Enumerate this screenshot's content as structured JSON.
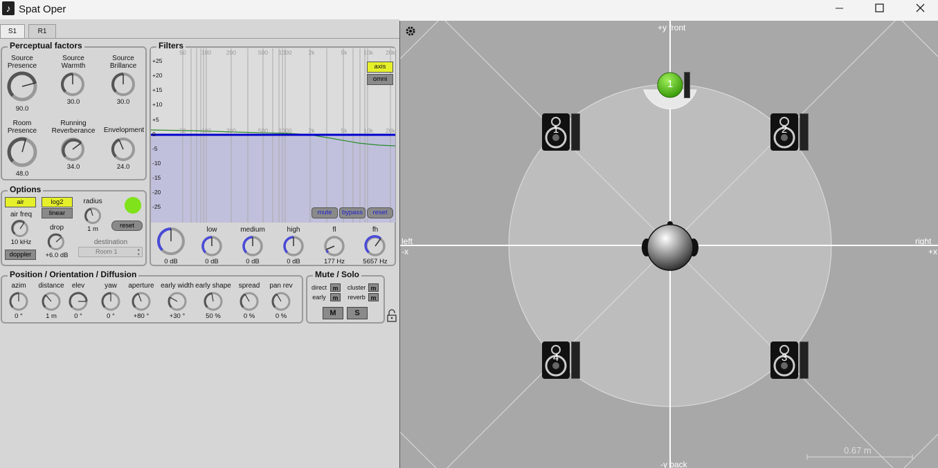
{
  "window": {
    "title": "Spat Oper",
    "app_icon": "music-note-icon",
    "controls": [
      "minimize-icon",
      "maximize-icon",
      "close-icon"
    ]
  },
  "tabs": [
    {
      "label": "S1",
      "active": true
    },
    {
      "label": "R1",
      "active": false
    }
  ],
  "perceptual": {
    "title": "Perceptual factors",
    "knobs": [
      {
        "label": "Source Presence",
        "value": "90.0"
      },
      {
        "label": "Source Warmth",
        "value": "30.0"
      },
      {
        "label": "Source Brillance",
        "value": "30.0"
      },
      {
        "label": "Room Presence",
        "value": "48.0"
      },
      {
        "label": "Running Reverberance",
        "value": "34.0"
      },
      {
        "label": "Envelopment",
        "value": "24.0"
      }
    ]
  },
  "filters": {
    "title": "Filters",
    "freq_labels": [
      "50",
      "100",
      "200",
      "500",
      "1000",
      "2k",
      "5k",
      "10k",
      "20k"
    ],
    "db_labels": [
      "+25",
      "+20",
      "+15",
      "+10",
      "+5",
      "0",
      "-5",
      "-10",
      "-15",
      "-20",
      "-25"
    ],
    "axis_label": "axis",
    "omni_label": "omni",
    "mute_label": "mute",
    "bypass_label": "bypass",
    "reset_label": "reset",
    "knobs": [
      {
        "label": "",
        "value": "0 dB"
      },
      {
        "label": "low",
        "value": "0 dB"
      },
      {
        "label": "medium",
        "value": "0 dB"
      },
      {
        "label": "high",
        "value": "0 dB"
      },
      {
        "label": "fl",
        "value": "177 Hz"
      },
      {
        "label": "fh",
        "value": "5657 Hz"
      }
    ]
  },
  "options": {
    "title": "Options",
    "air_label": "air",
    "log2_label": "log2",
    "linear_label": "linear",
    "radius_label": "radius",
    "radius_value": "1 m",
    "reset_label": "reset",
    "air_freq_label": "air freq",
    "air_freq_value": "10 kHz",
    "drop_label": "drop",
    "drop_value": "+6.0 dB",
    "destination_label": "destination",
    "destination_value": "Room 1",
    "doppler_label": "doppler"
  },
  "position": {
    "title": "Position / Orientation / Diffusion",
    "knobs": [
      {
        "label": "azim",
        "value": "0 °"
      },
      {
        "label": "distance",
        "value": "1 m"
      },
      {
        "label": "elev",
        "value": "0 °"
      },
      {
        "label": "yaw",
        "value": "0 °"
      },
      {
        "label": "aperture",
        "value": "+80 °"
      },
      {
        "label": "early width",
        "value": "+30 °"
      },
      {
        "label": "early shape",
        "value": "50 %"
      },
      {
        "label": "spread",
        "value": "0 %"
      },
      {
        "label": "pan rev",
        "value": "0 %"
      }
    ]
  },
  "mute_solo": {
    "title": "Mute / Solo",
    "direct_label": "direct",
    "cluster_label": "cluster",
    "early_label": "early",
    "reverb_label": "reverb",
    "m_label": "m",
    "M_label": "M",
    "S_label": "S"
  },
  "spatial": {
    "front_label": "+y front",
    "back_label": "-y back",
    "left_label": "left",
    "left_sub": "-x",
    "right_label": "right",
    "right_sub": "+x",
    "scale_label": "0.67 m",
    "source_label": "1",
    "speakers": [
      "1",
      "2",
      "3",
      "4"
    ]
  },
  "colors": {
    "accent_yellow": "#e6f02a",
    "source_green": "#5fc416",
    "filter_blue": "#0000cc",
    "knob_blue": "#4a4ad8"
  }
}
